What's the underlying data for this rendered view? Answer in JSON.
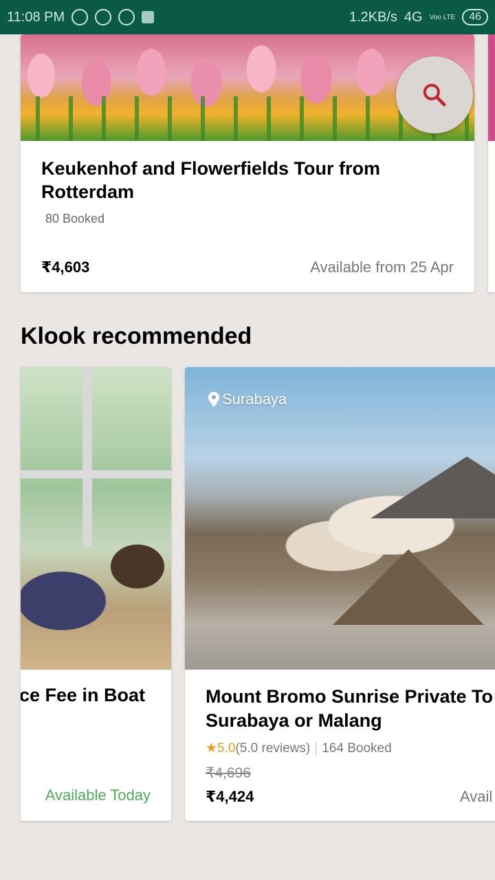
{
  "status_bar": {
    "time": "11:08 PM",
    "speed": "1.2KB/s",
    "network": "4G",
    "carrier_tag": "Voo LTE",
    "battery": "46"
  },
  "top_card": {
    "title": "Keukenhof and Flowerfields Tour from Rotterdam",
    "booked": "80 Booked",
    "price": "₹4,603",
    "availability": "Available from 25 Apr"
  },
  "search_fab": {
    "icon": "search-icon"
  },
  "section": {
    "title": "Klook recommended"
  },
  "recommended": [
    {
      "title": "ce Fee in Boat",
      "availability": "Available Today"
    },
    {
      "location": "Surabaya",
      "title": "Mount Bromo Sunrise Private To Surabaya or Malang",
      "rating": "5.0",
      "reviews": "(5.0 reviews)",
      "booked": "164 Booked",
      "original_price": "₹4,696",
      "price": "₹4,424",
      "availability": "Avail"
    }
  ],
  "colors": {
    "status_bar": "#0a5a45",
    "background": "#e9e6e4",
    "available_green": "#4caf50",
    "rating_orange": "#f29b1b",
    "search_red": "#c0262d"
  }
}
